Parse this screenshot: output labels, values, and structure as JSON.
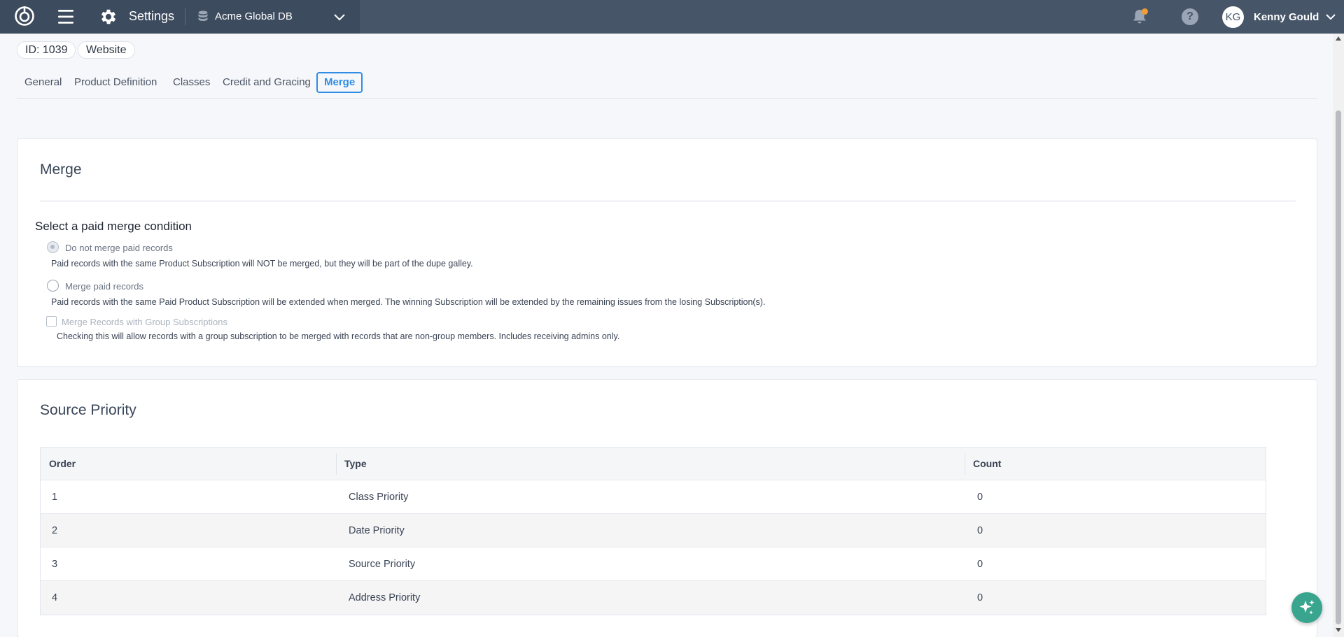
{
  "topbar": {
    "section_title": "Settings",
    "database_name": "Acme Global DB",
    "user_initials": "KG",
    "user_name": "Kenny Gould",
    "help_glyph": "?",
    "notification_dot_color": "#f39c32"
  },
  "record": {
    "id_label": "ID: 1039",
    "type_label": "Website"
  },
  "tabs": [
    {
      "label": "General"
    },
    {
      "label": "Product Definition"
    },
    {
      "label": "Classes"
    },
    {
      "label": "Credit and Gracing"
    },
    {
      "label": "Merge",
      "active": true
    }
  ],
  "merge": {
    "title": "Merge",
    "heading": "Select a paid merge condition",
    "options": [
      {
        "label": "Do not merge paid records",
        "description": "Paid records with the same Product Subscription will NOT be merged, but they will be part of the dupe galley.",
        "selected": true
      },
      {
        "label": "Merge paid records",
        "description": "Paid records with the same Paid Product Subscription will be extended when merged. The winning Subscription will be extended by the remaining issues from the losing Subscription(s).",
        "selected": false
      }
    ],
    "group_checkbox": {
      "label": "Merge Records with Group Subscriptions",
      "description": "Checking this will allow records with a group subscription to be merged with records that are non-group members. Includes receiving admins only.",
      "checked": false
    }
  },
  "source_priority": {
    "title": "Source Priority",
    "columns": [
      "Order",
      "Type",
      "Count"
    ],
    "rows": [
      [
        "1",
        "Class Priority",
        "0"
      ],
      [
        "2",
        "Date Priority",
        "0"
      ],
      [
        "3",
        "Source Priority",
        "0"
      ],
      [
        "4",
        "Address Priority",
        "0"
      ]
    ]
  },
  "colors": {
    "topbar": "#465568",
    "accent": "#2f8de4",
    "fab": "#3aa58f"
  }
}
